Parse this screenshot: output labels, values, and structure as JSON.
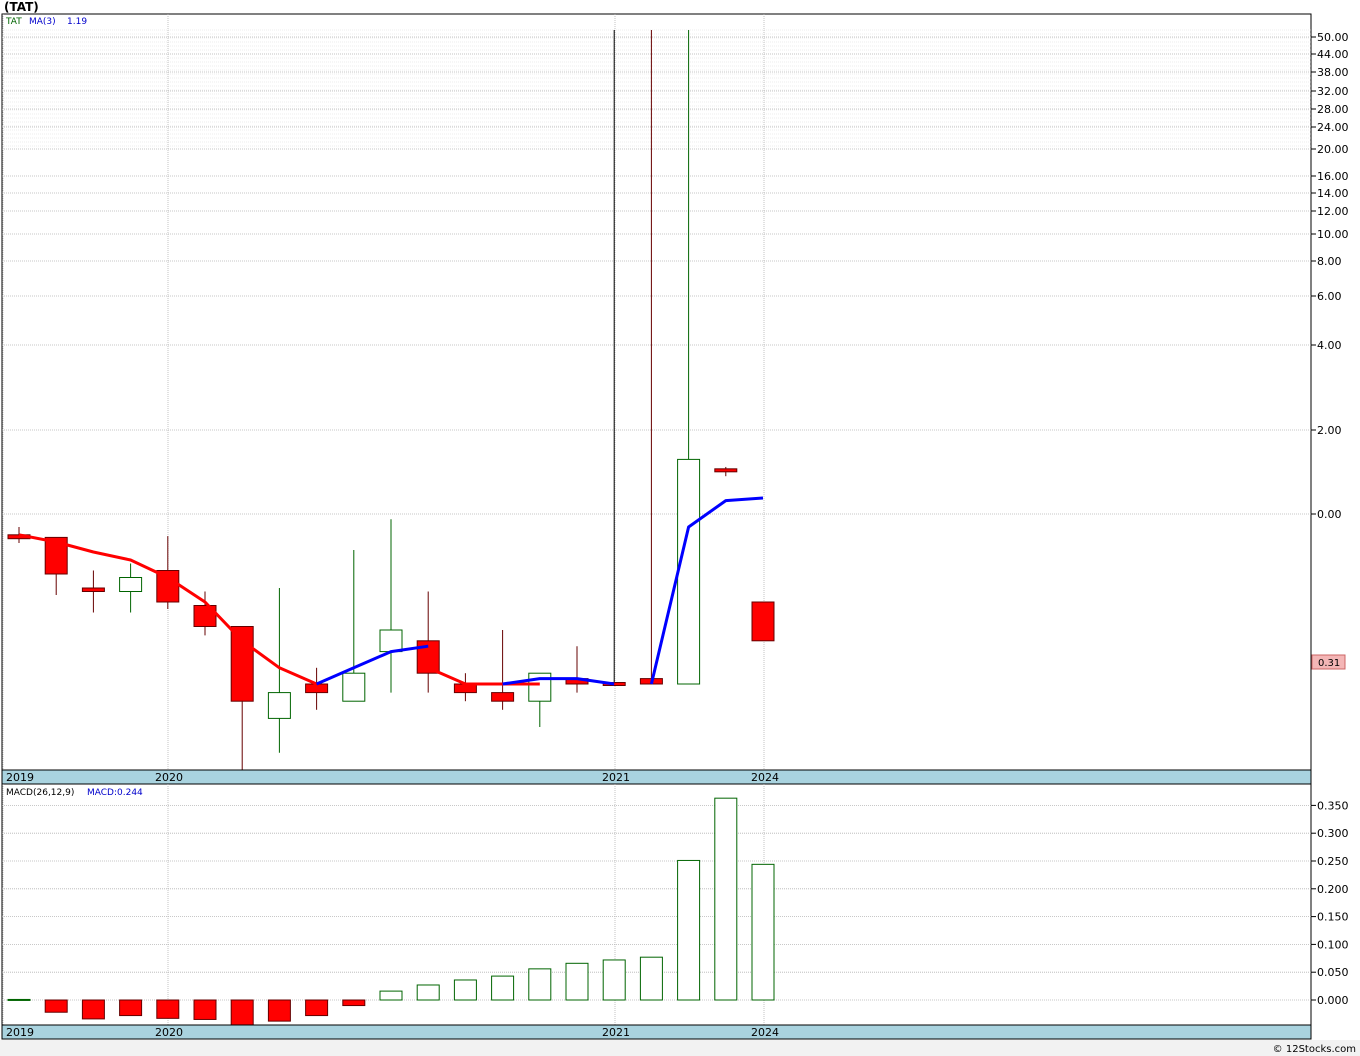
{
  "header": {
    "title": "(TAT)",
    "credit": "© 12Stocks.com"
  },
  "chart_data": [
    {
      "type": "candlestick",
      "legend": {
        "symbol": "TAT",
        "ma_label": "MA(3)",
        "ma_value": "1.19"
      },
      "price_tag": "0.31",
      "y_ticks": [
        "50.00",
        "44.00",
        "38.00",
        "32.00",
        "28.00",
        "24.00",
        "20.00",
        "16.00",
        "14.00",
        "12.00",
        "10.00",
        "8.00",
        "6.00",
        "4.00",
        "2.00",
        "0.00"
      ],
      "x_labels": [
        "2019",
        "2020",
        "2021",
        "2024"
      ],
      "candles": [
        {
          "open": 0.84,
          "high": 0.9,
          "low": 0.77,
          "close": 0.81
        },
        {
          "open": 0.82,
          "high": 0.82,
          "low": 0.5,
          "close": 0.56
        },
        {
          "open": 0.52,
          "high": 0.57,
          "low": 0.45,
          "close": 0.51
        },
        {
          "open": 0.51,
          "high": 0.59,
          "low": 0.45,
          "close": 0.55
        },
        {
          "open": 0.57,
          "high": 0.83,
          "low": 0.46,
          "close": 0.48
        },
        {
          "open": 0.47,
          "high": 0.51,
          "low": 0.39,
          "close": 0.41
        },
        {
          "open": 0.41,
          "high": 0.41,
          "low": 0.2,
          "close": 0.28
        },
        {
          "open": 0.26,
          "high": 0.52,
          "low": 0.22,
          "close": 0.29
        },
        {
          "open": 0.3,
          "high": 0.33,
          "low": 0.27,
          "close": 0.29
        },
        {
          "open": 0.28,
          "high": 0.7,
          "low": 0.28,
          "close": 0.32
        },
        {
          "open": 0.36,
          "high": 0.96,
          "low": 0.29,
          "close": 0.4
        },
        {
          "open": 0.38,
          "high": 0.51,
          "low": 0.29,
          "close": 0.32
        },
        {
          "open": 0.3,
          "high": 0.32,
          "low": 0.28,
          "close": 0.29
        },
        {
          "open": 0.29,
          "high": 0.4,
          "low": 0.27,
          "close": 0.28
        },
        {
          "open": 0.28,
          "high": 0.32,
          "low": 0.25,
          "close": 0.32
        },
        {
          "open": 0.31,
          "high": 0.37,
          "low": 0.29,
          "close": 0.3
        },
        {
          "open": 0.3,
          "high": 60.0,
          "low": 0.3,
          "close": 0.3
        },
        {
          "open": 0.31,
          "high": 60.0,
          "low": 0.3,
          "close": 0.3
        },
        {
          "open": 0.3,
          "high": 60.0,
          "low": 0.3,
          "close": 1.65
        },
        {
          "open": 1.52,
          "high": 1.56,
          "low": 1.45,
          "close": 1.52
        },
        {
          "open": 0.48,
          "high": 0.48,
          "low": 0.38,
          "close": 0.38
        }
      ],
      "ma": [
        [
          0.84,
          0.78,
          0.68,
          0.6,
          0.55,
          0.48,
          0.38,
          0.33,
          0.3
        ],
        [
          0.3,
          0.33,
          0.36,
          0.37
        ],
        [
          0.33,
          0.3,
          0.3,
          0.3
        ],
        [
          0.3,
          0.31,
          0.31,
          0.3
        ],
        [
          0.3,
          0.9,
          1.16,
          1.19
        ]
      ]
    },
    {
      "type": "bar",
      "legend": {
        "name": "MACD(26,12,9)",
        "value": "MACD:0.244"
      },
      "y_ticks": [
        "0.350",
        "0.300",
        "0.250",
        "0.200",
        "0.150",
        "0.100",
        "0.050",
        "0.000"
      ],
      "ylim": [
        -0.045,
        0.375
      ],
      "x_labels": [
        "2019",
        "2020",
        "2021",
        "2024"
      ],
      "values": [
        0.001,
        -0.022,
        -0.034,
        -0.028,
        -0.033,
        -0.035,
        -0.045,
        -0.038,
        -0.028,
        -0.01,
        0.016,
        0.027,
        0.036,
        0.043,
        0.056,
        0.066,
        0.072,
        0.077,
        0.251,
        0.363,
        0.244
      ]
    }
  ]
}
